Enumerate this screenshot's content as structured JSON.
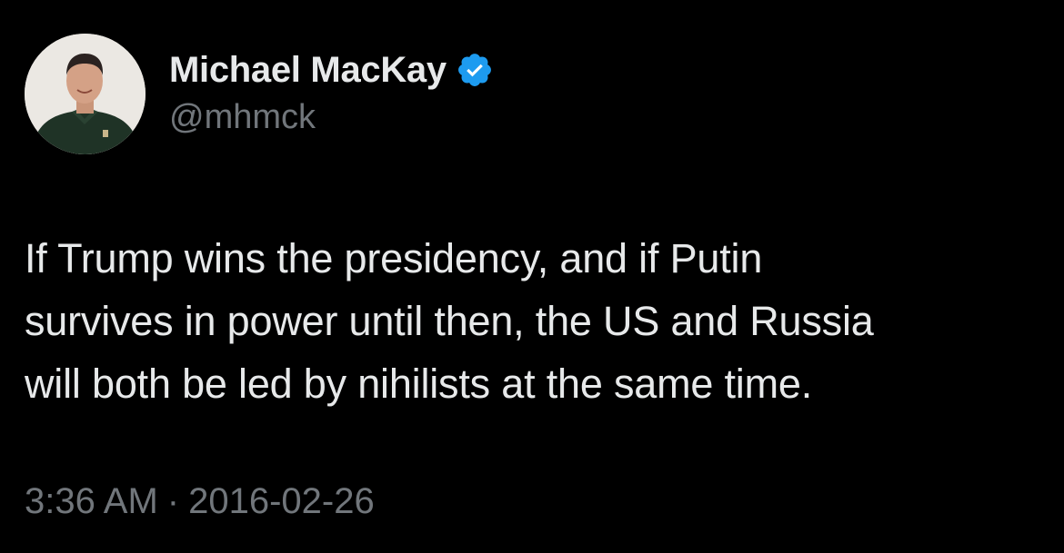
{
  "author": {
    "display_name": "Michael MacKay",
    "handle": "@mhmck",
    "verified": true,
    "verified_color": "#1d9bf0"
  },
  "tweet": {
    "lines": [
      "If Trump wins the presidency, and if Putin",
      "survives in power until then, the US and Russia",
      "will both be led by nihilists at the same time."
    ]
  },
  "meta": {
    "time": "3:36 AM",
    "separator": "·",
    "date": "2016-02-26"
  },
  "colors": {
    "background": "#000000",
    "primary_text": "#e7e9ea",
    "secondary_text": "#71767b"
  }
}
